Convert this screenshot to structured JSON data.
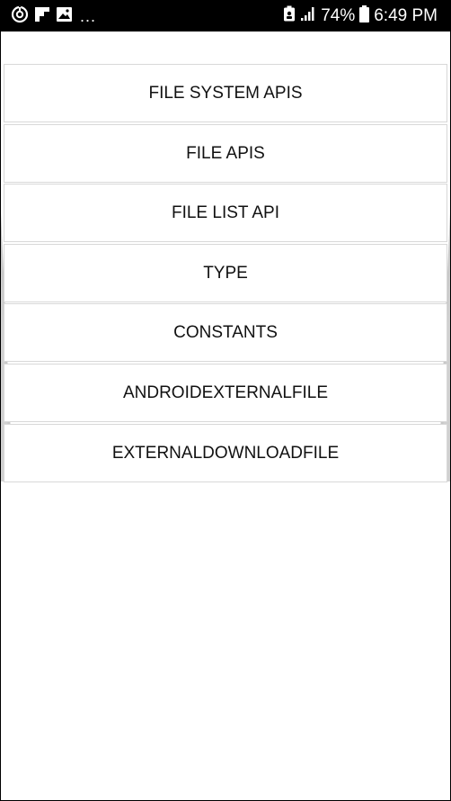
{
  "status_bar": {
    "notification_icons": [
      "sync-icon",
      "flipboard-icon",
      "gallery-icon"
    ],
    "overflow": "...",
    "battery_percent": "74%",
    "time": "6:49 PM"
  },
  "menu": {
    "items": [
      {
        "label": "FILE SYSTEM APIS"
      },
      {
        "label": "FILE APIS"
      },
      {
        "label": "FILE LIST API"
      },
      {
        "label": "TYPE"
      },
      {
        "label": "CONSTANTS"
      },
      {
        "label": "ANDROIDEXTERNALFILE"
      },
      {
        "label": "EXTERNALDOWNLOADFILE"
      }
    ]
  },
  "colors": {
    "status_bar_bg": "#000000",
    "background": "#ffffff",
    "item_border": "#d8d8d8",
    "side_shadow": "#c8c8c8",
    "text": "#111111"
  }
}
